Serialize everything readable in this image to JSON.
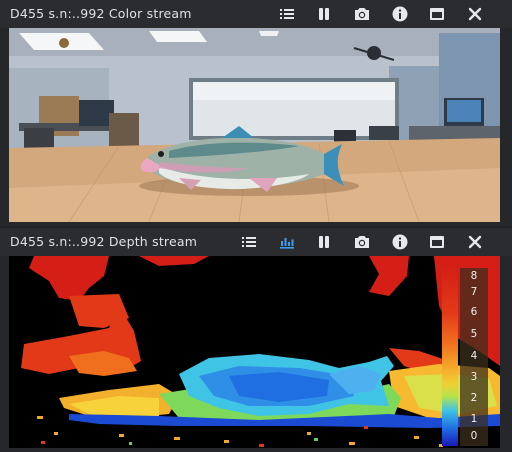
{
  "color_panel": {
    "title": "D455 s.n:..992 Color stream",
    "icons": [
      "list-icon",
      "pause-icon",
      "camera-icon",
      "info-icon",
      "window-icon",
      "close-icon"
    ]
  },
  "depth_panel": {
    "title": "D455 s.n:..992 Depth stream",
    "icons": [
      "list-icon",
      "histogram-icon",
      "pause-icon",
      "camera-icon",
      "info-icon",
      "window-icon",
      "close-icon"
    ],
    "active_icon": "histogram-icon",
    "colorbar": {
      "labels": [
        "8",
        "7",
        "6",
        "5",
        "4",
        "3",
        "2",
        "1",
        "0"
      ],
      "colors": [
        "#d51f16",
        "#e23a18",
        "#f06f1d",
        "#f7a42a",
        "#f0cf35",
        "#b7e34a",
        "#3fc4e6",
        "#1f6fe3",
        "#1a1ab8"
      ]
    }
  },
  "colors": {
    "accent": "#3d9cf0",
    "icon": "#e6e8eb"
  }
}
